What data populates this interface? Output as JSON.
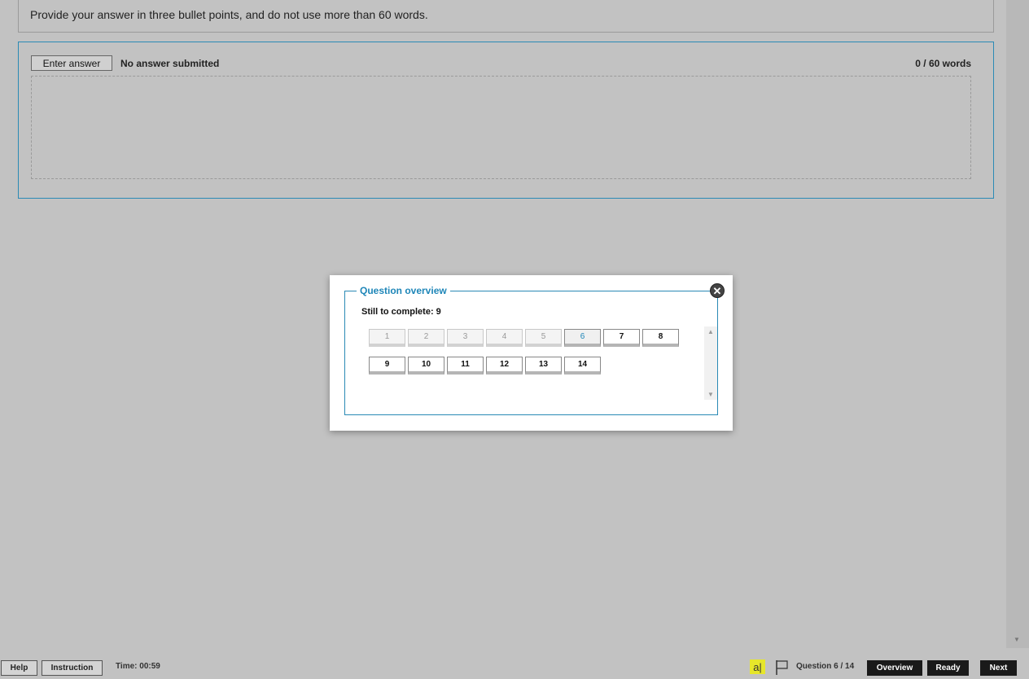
{
  "instruction": "Provide your answer in three bullet points, and do not use more than 60 words.",
  "answer": {
    "enter_button": "Enter answer",
    "status": "No answer submitted",
    "word_count": "0 / 60 words"
  },
  "overview": {
    "title": "Question overview",
    "still_to_complete": "Still to complete: 9",
    "close_icon": "close-icon",
    "questions": [
      {
        "label": "1",
        "state": "done"
      },
      {
        "label": "2",
        "state": "done"
      },
      {
        "label": "3",
        "state": "done"
      },
      {
        "label": "4",
        "state": "done"
      },
      {
        "label": "5",
        "state": "done"
      },
      {
        "label": "6",
        "state": "current"
      },
      {
        "label": "7",
        "state": "open"
      },
      {
        "label": "8",
        "state": "open"
      },
      {
        "label": "9",
        "state": "open"
      },
      {
        "label": "10",
        "state": "open"
      },
      {
        "label": "11",
        "state": "open"
      },
      {
        "label": "12",
        "state": "open"
      },
      {
        "label": "13",
        "state": "open"
      },
      {
        "label": "14",
        "state": "open"
      }
    ]
  },
  "footer": {
    "help": "Help",
    "instruction": "Instruction",
    "timer": "Time: 00:59",
    "highlight_icon": "a|",
    "question_counter": "Question 6 / 14",
    "overview": "Overview",
    "ready": "Ready",
    "next": "Next"
  },
  "colors": {
    "accent": "#1e86b8",
    "background": "#c2c2c2",
    "highlight": "#e6e62a"
  }
}
